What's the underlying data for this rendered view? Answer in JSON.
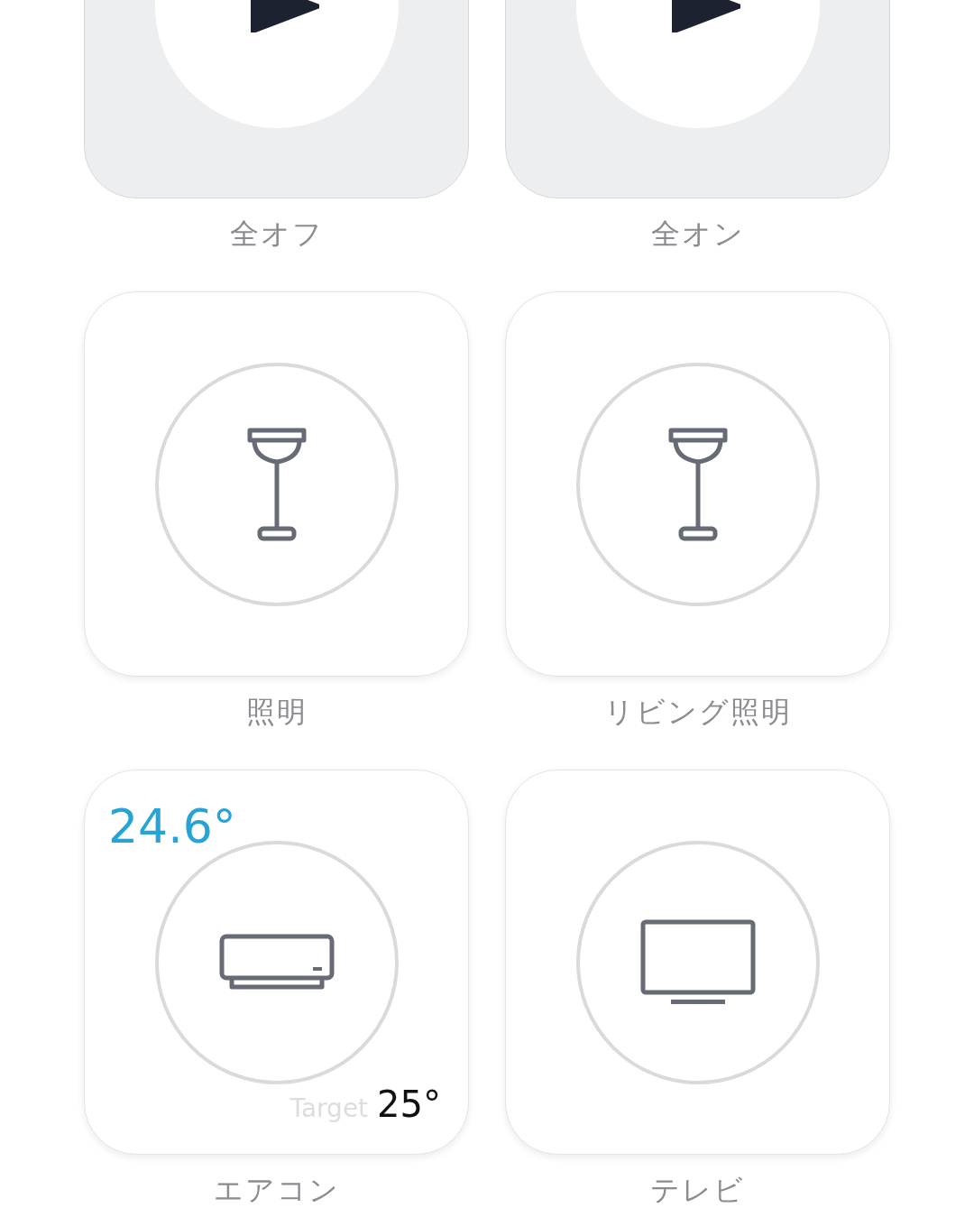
{
  "tiles": [
    {
      "kind": "scene",
      "label": "全オフ"
    },
    {
      "kind": "scene",
      "label": "全オン"
    },
    {
      "kind": "lamp",
      "label": "照明"
    },
    {
      "kind": "lamp",
      "label": "リビング照明"
    },
    {
      "kind": "aircon",
      "label": "エアコン",
      "current_temp": "24.6°",
      "target_label": "Target",
      "target_temp": "25°"
    },
    {
      "kind": "tv",
      "label": "テレビ"
    }
  ]
}
